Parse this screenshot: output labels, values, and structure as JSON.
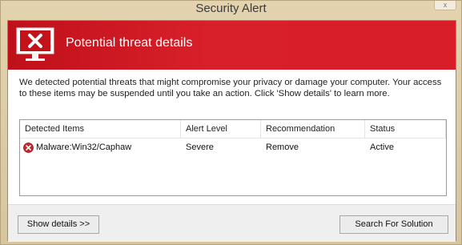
{
  "window": {
    "title": "Security Alert",
    "close_label": "x"
  },
  "banner": {
    "title": "Potential threat details",
    "icon": "monitor-x-icon",
    "color": "#d01c25"
  },
  "description": "We detected potential threats that might compromise your privacy or damage your computer. Your access to these items may be suspended until you take an action. Click 'Show details' to learn more.",
  "table": {
    "columns": [
      "Detected Items",
      "Alert Level",
      "Recommendation",
      "Status"
    ],
    "rows": [
      {
        "icon": "error-icon",
        "item": "Malware:Win32/Caphaw",
        "level": "Severe",
        "recommendation": "Remove",
        "status": "Active"
      }
    ]
  },
  "footer": {
    "show_details_label": "Show details >>",
    "search_solution_label": "Search For Solution"
  }
}
